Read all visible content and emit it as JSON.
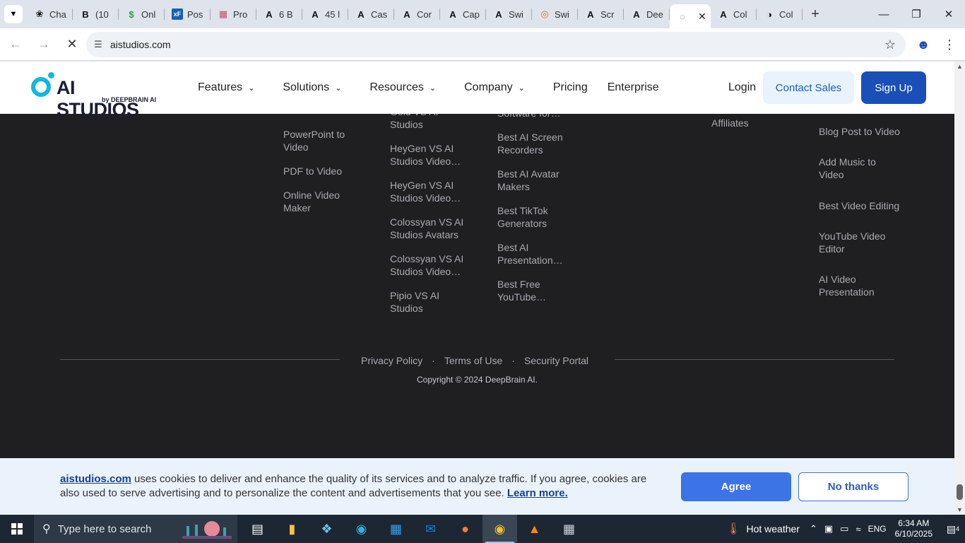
{
  "browser": {
    "tabs": [
      {
        "label": "Cha",
        "icon": "openai-icon"
      },
      {
        "label": "(10",
        "icon": "b-icon"
      },
      {
        "label": "Onl",
        "icon": "dollar-icon"
      },
      {
        "label": "Pos",
        "icon": "xf-icon"
      },
      {
        "label": "Pro",
        "icon": "grid-icon"
      },
      {
        "label": "6 B",
        "icon": "a-icon"
      },
      {
        "label": "45 l",
        "icon": "a-icon"
      },
      {
        "label": "Cas",
        "icon": "a-icon"
      },
      {
        "label": "Cor",
        "icon": "a-icon"
      },
      {
        "label": "Cap",
        "icon": "a-icon"
      },
      {
        "label": "Swi",
        "icon": "a-icon"
      },
      {
        "label": "Swi",
        "icon": "swirl-icon"
      },
      {
        "label": "Scr",
        "icon": "a-icon"
      },
      {
        "label": "Dee",
        "icon": "a-icon"
      },
      {
        "label": "",
        "icon": "loading-icon",
        "active": true
      },
      {
        "label": "Col",
        "icon": "a-icon"
      },
      {
        "label": "Col",
        "icon": "circle-icon"
      }
    ],
    "url": "aistudios.com"
  },
  "header": {
    "logo_text": "AI STUDIOS",
    "logo_by": "by DEEPBRAIN AI",
    "menu": [
      "Features",
      "Solutions",
      "Resources",
      "Company",
      "Pricing",
      "Enterprise"
    ],
    "login": "Login",
    "contact": "Contact Sales",
    "signup": "Sign Up"
  },
  "footer": {
    "col1": [
      "PowerPoint to Video",
      "PDF to Video",
      "Online Video Maker"
    ],
    "col2_partial": "Gold VS AI",
    "col2": [
      "Studios",
      "HeyGen VS AI Studios Video…",
      "HeyGen VS AI Studios Video…",
      "Colossyan VS AI Studios Avatars",
      "Colossyan VS AI Studios Video…",
      "Pipio VS AI Studios"
    ],
    "col3_partial": "Software for…",
    "col3": [
      "Best AI Screen Recorders",
      "Best AI Avatar Makers",
      "Best TikTok Generators",
      "Best AI Presentation…",
      "Best Free YouTube…"
    ],
    "col4": [
      "Affiliates"
    ],
    "col5": [
      "Blog Post to Video",
      "Add Music to Video",
      "Best Video Editing",
      "YouTube Video Editor",
      "AI Video Presentation"
    ],
    "legal": [
      "Privacy Policy",
      "Terms of Use",
      "Security Portal"
    ],
    "copyright": "Copyright © 2024 DeepBrain AI."
  },
  "cookie": {
    "site": "aistudios.com",
    "text": " uses cookies to deliver and enhance the quality of its services and to analyze traffic. If you agree, cookies are also used to serve advertising and to personalize the content and advertisements that you see. ",
    "learn_more": "Learn more.",
    "agree": "Agree",
    "no_thanks": "No thanks"
  },
  "taskbar": {
    "search_placeholder": "Type here to search",
    "weather": "Hot weather",
    "lang": "ENG",
    "time": "6:34 AM",
    "date": "6/10/2025",
    "notifications": "4"
  }
}
